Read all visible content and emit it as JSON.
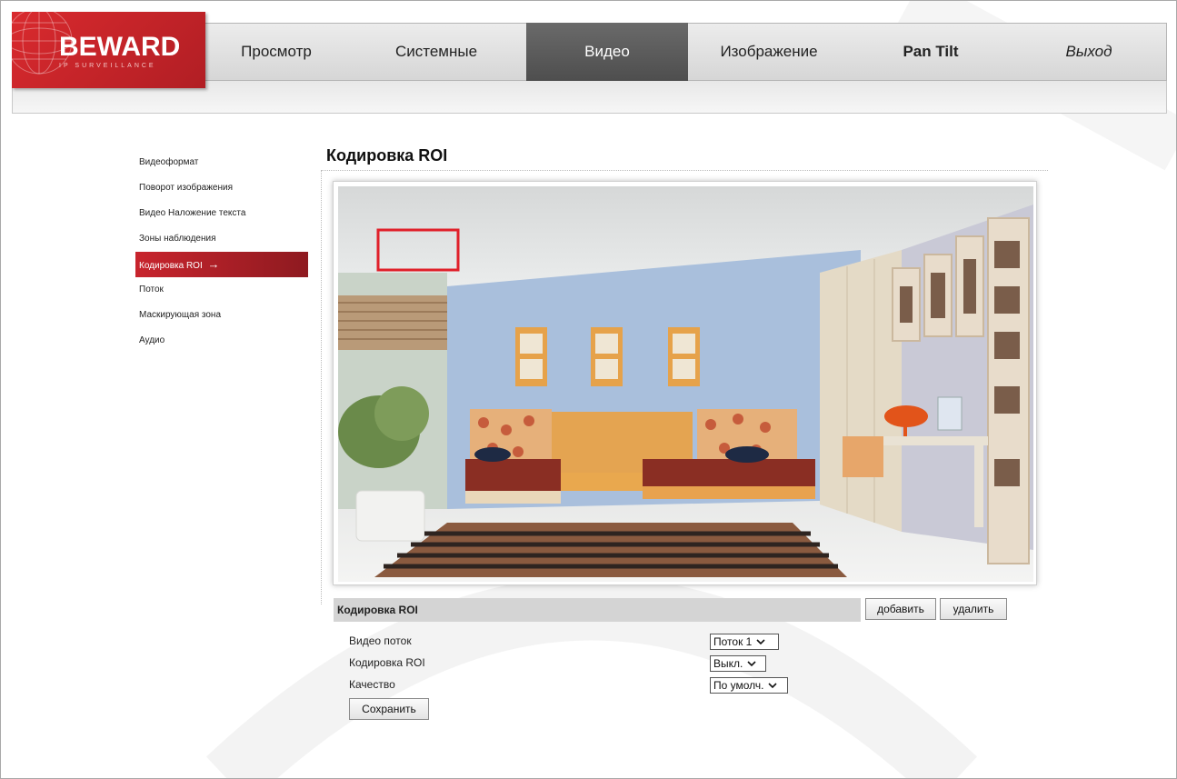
{
  "logo": {
    "brand": "BEWARD",
    "tagline": "IP SURVEILLANCE"
  },
  "nav": [
    {
      "label": "Просмотр",
      "active": false
    },
    {
      "label": "Системные",
      "active": false
    },
    {
      "label": "Видео",
      "active": true
    },
    {
      "label": "Изображение",
      "active": false
    },
    {
      "label": "Pan Tilt",
      "active": false
    },
    {
      "label": "Выход",
      "active": false
    }
  ],
  "sidebar": {
    "items": [
      {
        "label": "Видеоформат"
      },
      {
        "label": "Поворот изображения"
      },
      {
        "label": "Видео Наложение текста"
      },
      {
        "label": "Зоны наблюдения"
      },
      {
        "label": "Кодировка ROI",
        "active": true,
        "arrow": "→"
      },
      {
        "label": "Поток"
      },
      {
        "label": "Маскирующая зона"
      },
      {
        "label": "Аудио"
      }
    ]
  },
  "page": {
    "title": "Кодировка ROI"
  },
  "roi_section": {
    "header": "Кодировка ROI",
    "add_label": "добавить",
    "delete_label": "удалить"
  },
  "form": {
    "stream_label": "Видео поток",
    "stream_value": "Поток 1",
    "roi_label": "Кодировка ROI",
    "roi_value": "Выкл.",
    "quality_label": "Качество",
    "quality_value": "По умолч.",
    "save_label": "Сохранить"
  },
  "colors": {
    "accent": "#c8242d",
    "nav_active": "#5a5a5a",
    "roi_box": "#e0202a"
  }
}
